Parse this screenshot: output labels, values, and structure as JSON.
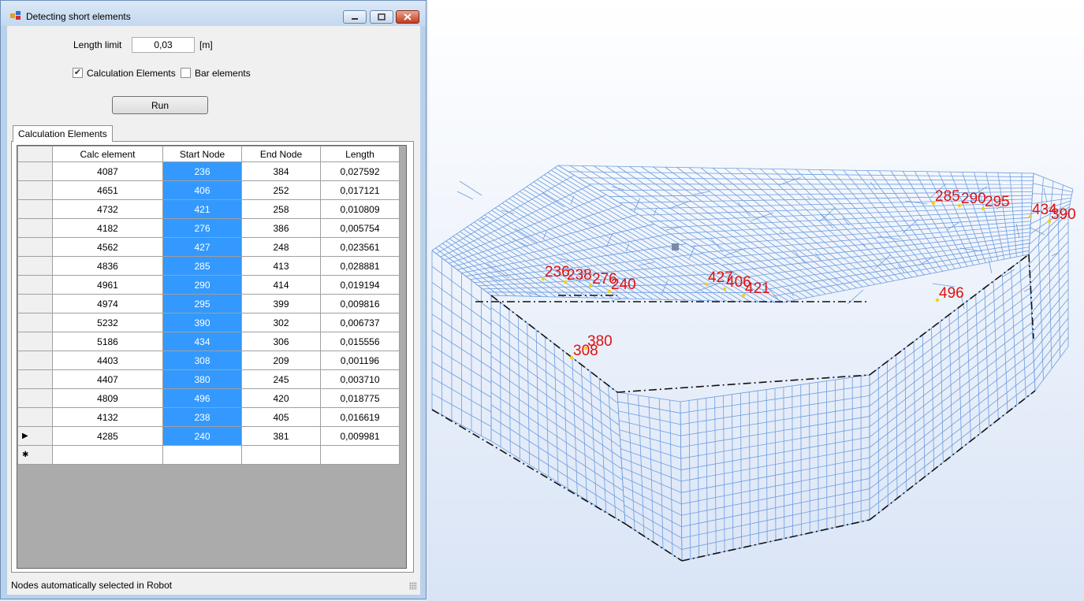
{
  "window": {
    "title": "Detecting short elements",
    "icon": "app-icon",
    "min_icon": "minimize-icon",
    "max_icon": "maximize-icon",
    "close_icon": "close-icon"
  },
  "form": {
    "length_label": "Length limit",
    "length_value": "0,03",
    "unit_label": "[m]",
    "calc_checkbox_label": "Calculation Elements",
    "calc_checked": true,
    "bar_checkbox_label": "Bar elements",
    "bar_checked": false,
    "run_label": "Run"
  },
  "tab": {
    "label": "Calculation Elements"
  },
  "grid": {
    "headers": [
      "Calc element",
      "Start Node",
      "End Node",
      "Length"
    ],
    "rows": [
      [
        "4087",
        "236",
        "384",
        "0,027592"
      ],
      [
        "4651",
        "406",
        "252",
        "0,017121"
      ],
      [
        "4732",
        "421",
        "258",
        "0,010809"
      ],
      [
        "4182",
        "276",
        "386",
        "0,005754"
      ],
      [
        "4562",
        "427",
        "248",
        "0,023561"
      ],
      [
        "4836",
        "285",
        "413",
        "0,028881"
      ],
      [
        "4961",
        "290",
        "414",
        "0,019194"
      ],
      [
        "4974",
        "295",
        "399",
        "0,009816"
      ],
      [
        "5232",
        "390",
        "302",
        "0,006737"
      ],
      [
        "5186",
        "434",
        "306",
        "0,015556"
      ],
      [
        "4403",
        "308",
        "209",
        "0,001196"
      ],
      [
        "4407",
        "380",
        "245",
        "0,003710"
      ],
      [
        "4809",
        "496",
        "420",
        "0,018775"
      ],
      [
        "4132",
        "238",
        "405",
        "0,016619"
      ],
      [
        "4285",
        "240",
        "381",
        "0,009981"
      ]
    ],
    "current_row_marker": "▶",
    "new_row_marker": "✱"
  },
  "status": {
    "text": "Nodes automatically selected in Robot"
  },
  "viewport": {
    "node_labels": [
      "236",
      "238",
      "276",
      "240",
      "427",
      "406",
      "421",
      "285",
      "290",
      "295",
      "434",
      "390",
      "496",
      "380",
      "308"
    ],
    "label_color": "#e01010",
    "mesh_color": "#6d9de0"
  }
}
